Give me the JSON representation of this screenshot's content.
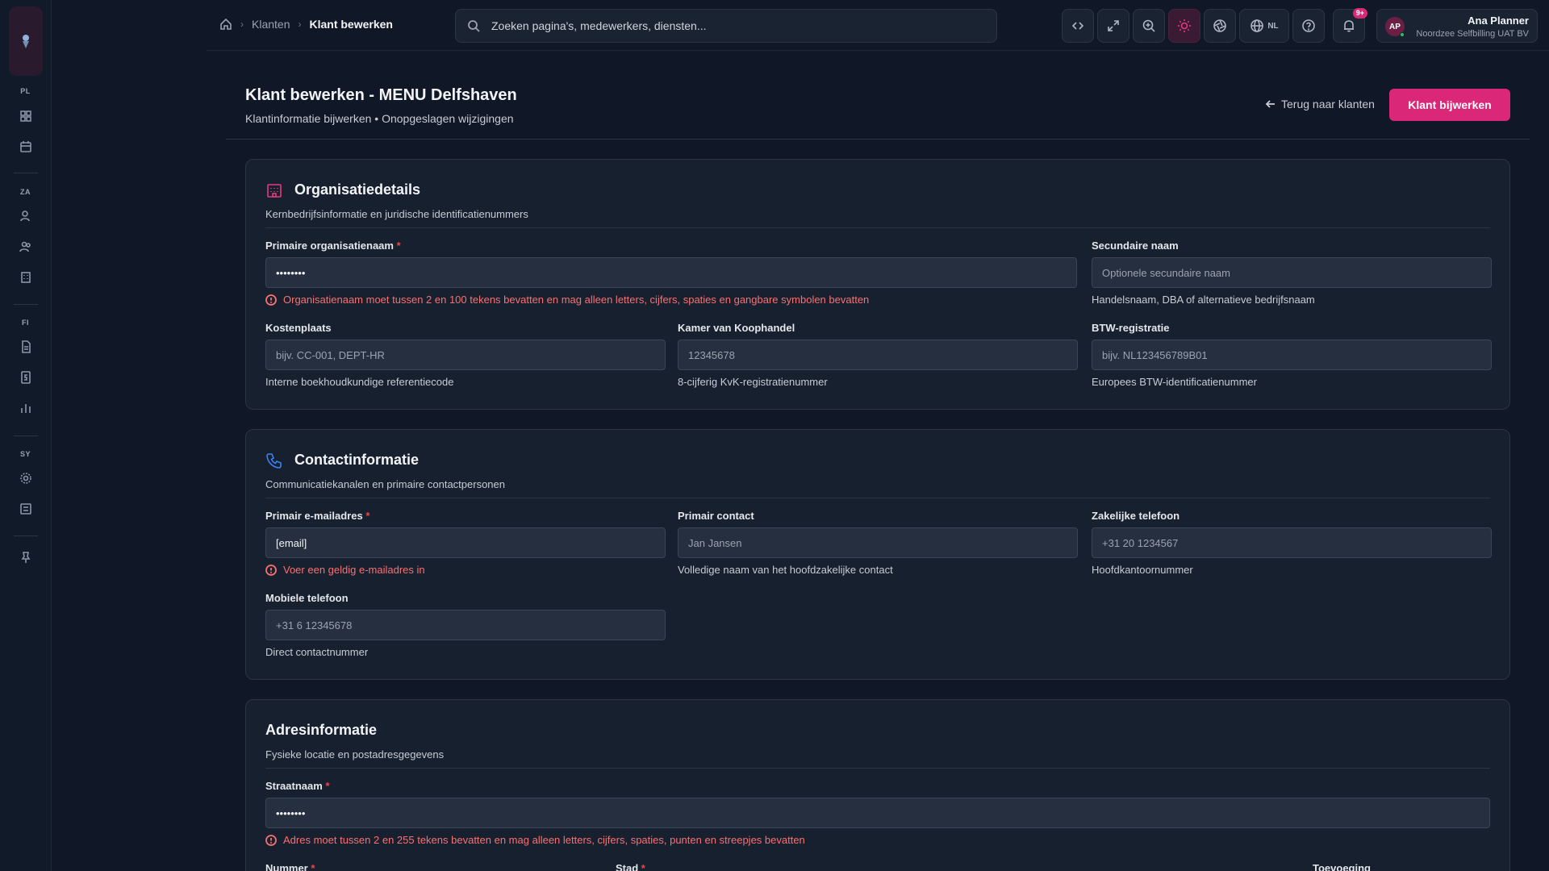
{
  "breadcrumb": {
    "items": [
      "Klanten",
      "Klant bewerken"
    ]
  },
  "search": {
    "placeholder": "Zoeken pagina's, medewerkers, diensten..."
  },
  "toolbar": {
    "language": "NL",
    "notifications_badge": "9+"
  },
  "user": {
    "initials": "AP",
    "name": "Ana Planner",
    "org": "Noordzee Selfbilling UAT BV"
  },
  "sidebar": {
    "sections": [
      "PL",
      "ZA",
      "FI",
      "SY"
    ]
  },
  "page": {
    "title": "Klant bewerken - MENU Delfshaven",
    "subtitle": "Klantinformatie bijwerken • Onopgeslagen wijzigingen",
    "back_label": "Terug naar klanten",
    "submit_label": "Klant bijwerken"
  },
  "org": {
    "title": "Organisatiedetails",
    "desc": "Kernbedrijfsinformatie en juridische identificatienummers",
    "primary_name": {
      "label": "Primaire organisatienaam",
      "value": "••••••••",
      "error": "Organisatienaam moet tussen 2 en 100 tekens bevatten en mag alleen letters, cijfers, spaties en gangbare symbolen bevatten"
    },
    "secondary_name": {
      "label": "Secundaire naam",
      "placeholder": "Optionele secundaire naam",
      "help": "Handelsnaam, DBA of alternatieve bedrijfsnaam"
    },
    "cost_center": {
      "label": "Kostenplaats",
      "placeholder": "bijv. CC-001, DEPT-HR",
      "help": "Interne boekhoudkundige referentiecode"
    },
    "kvk": {
      "label": "Kamer van Koophandel",
      "placeholder": "12345678",
      "help": "8-cijferig KvK-registratienummer"
    },
    "vat": {
      "label": "BTW-registratie",
      "placeholder": "bijv. NL123456789B01",
      "help": "Europees BTW-identificatienummer"
    }
  },
  "contact": {
    "title": "Contactinformatie",
    "desc": "Communicatiekanalen en primaire contactpersonen",
    "email": {
      "label": "Primair e-mailadres",
      "value": "[email]",
      "error": "Voer een geldig e-mailadres in"
    },
    "primary_contact": {
      "label": "Primair contact",
      "placeholder": "Jan Jansen",
      "help": "Volledige naam van het hoofdzakelijke contact"
    },
    "business_phone": {
      "label": "Zakelijke telefoon",
      "placeholder": "+31 20 1234567",
      "help": "Hoofdkantoornummer"
    },
    "mobile_phone": {
      "label": "Mobiele telefoon",
      "placeholder": "+31 6 12345678",
      "help": "Direct contactnummer"
    }
  },
  "address": {
    "title": "Adresinformatie",
    "desc": "Fysieke locatie en postadresgegevens",
    "street": {
      "label": "Straatnaam",
      "value": "••••••••",
      "error": "Adres moet tussen 2 en 255 tekens bevatten en mag alleen letters, cijfers, spaties, punten en streepjes bevatten"
    },
    "number": {
      "label": "Nummer"
    },
    "city": {
      "label": "Stad"
    },
    "addition": {
      "label": "Toevoeging"
    }
  },
  "colors": {
    "accent": "#db2777",
    "error": "#f87171",
    "background": "#101827",
    "card": "#17202f"
  }
}
